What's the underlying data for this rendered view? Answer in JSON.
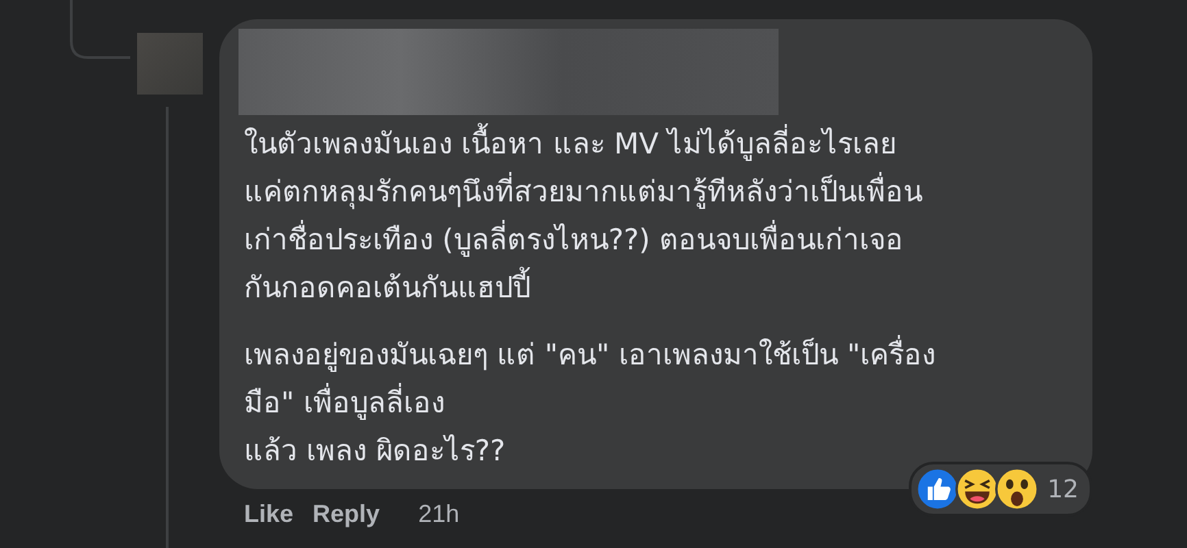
{
  "comment": {
    "paragraphs": [
      [
        "ในตัวเพลงมันเอง เนื้อหา และ MV ไม่ได้บูลลี่อะไรเลย",
        "แค่ตกหลุมรักคนๆนึงที่สวยมากแต่มารู้ทีหลังว่าเป็นเพื่อน",
        "เก่าชื่อประเทือง (บูลลี่ตรงไหน??) ตอนจบเพื่อนเก่าเจอ",
        "กันกอดคอเต้นกันแฮปปี้"
      ],
      [
        "เพลงอยู่ของมันเฉยๆ แต่ \"คน\" เอาเพลงมาใช้เป็น \"เครื่อง",
        "มือ\" เพื่อบูลลี่เอง",
        "แล้ว เพลง ผิดอะไร??"
      ]
    ],
    "reactions": [
      {
        "kind": "like"
      },
      {
        "kind": "haha"
      },
      {
        "kind": "wow"
      }
    ],
    "reaction_count": "12",
    "actions": [
      "Like",
      "Reply"
    ],
    "timestamp": "21h"
  }
}
